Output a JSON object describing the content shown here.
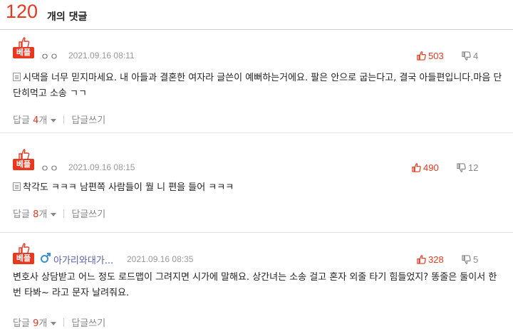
{
  "header": {
    "count": "120",
    "count_label": "개의 댓글"
  },
  "comments": [
    {
      "badge": "베플",
      "author": "ㅇㅇ",
      "date": "2021.09.16 08:11",
      "up": "503",
      "down": "4",
      "text": "시댁을 너무 믿지마세요. 내 아들과 결혼한 여자라 글쓴이 예뻐하는거에요. 팔은 안으로 굽는다고, 결국 아들편입니다.마음 단단히먹고 소송 ㄱㄱ",
      "reply_label": "답글",
      "reply_count": "4",
      "reply_unit": "개",
      "write_reply": "답글쓰기"
    },
    {
      "badge": "베플",
      "author": "ㅇㅇ",
      "date": "2021.09.16 08:15",
      "up": "490",
      "down": "12",
      "text": "착각도 ㅋㅋㅋ 남편쪽 사람들이 뭘 니 편을 들어 ㅋㅋㅋ",
      "reply_label": "답글",
      "reply_count": "8",
      "reply_unit": "개",
      "write_reply": "답글쓰기"
    },
    {
      "badge": "베플",
      "author": "아가리와대가...",
      "date": "2021.09.16 08:35",
      "up": "328",
      "down": "5",
      "text": "변호사 상담받고 어느 정도 로드맵이 그려지면 시가에 말해요. 상간녀는 소송 걸고 혼자 외줄 타기 힘들었지? 똥줄은 둘이서 한 번 타봐~ 라고 문자 날려줘요.",
      "reply_label": "답글",
      "reply_count": "9",
      "reply_unit": "개",
      "write_reply": "답글쓰기"
    }
  ],
  "colors": {
    "accent": "#e8381f",
    "author_link": "#5a5fae",
    "muted": "#999999"
  },
  "icons": [
    "thumbs-up-icon",
    "thumbs-down-icon",
    "memo-icon",
    "male-icon",
    "chevron-down-icon"
  ]
}
